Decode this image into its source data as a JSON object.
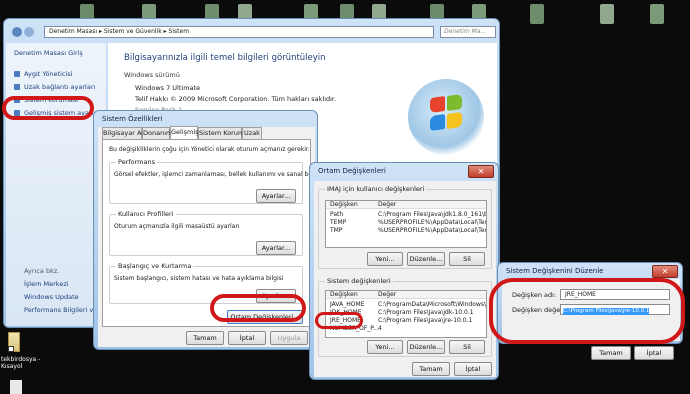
{
  "control_panel": {
    "address": [
      "Denetim Masası",
      "Sistem ve Güvenlik",
      "Sistem"
    ],
    "search_placeholder": "Denetim Ma...",
    "sidebar_home": "Denetim Masası Giriş",
    "sidebar_items": [
      "Aygıt Yöneticisi",
      "Uzak bağlantı ayarları",
      "Sistem koruması",
      "Gelişmiş sistem ayarları"
    ],
    "see_also_title": "Ayrıca bkz.",
    "see_also": [
      "İşlem Merkezi",
      "Windows Update",
      "Performans Bilgileri ve Ara..."
    ],
    "heading": "Bilgisayarınızla ilgili temel bilgileri görüntüleyin",
    "edition_label": "Windows sürümü",
    "edition": "Windows 7 Ultimate",
    "copyright": "Telif Hakkı © 2009 Microsoft Corporation. Tüm hakları saklıdır.",
    "service_pack": "Service Pack 1"
  },
  "system_properties": {
    "title": "Sistem Özellikleri",
    "tabs": [
      "Bilgisayar Adı",
      "Donanım",
      "Gelişmiş",
      "Sistem Koruması",
      "Uzak"
    ],
    "admin_note": "Bu değişikliklerin çoğu için Yönetici olarak oturum açmanız gerekir.",
    "performance": {
      "title": "Performans",
      "desc": "Görsel efektler, işlemci zamanlaması, bellek kullanımı ve sanal bellek",
      "button": "Ayarlar..."
    },
    "user_profiles": {
      "title": "Kullanıcı Profilleri",
      "desc": "Oturum açmanızla ilgili masaüstü ayarları",
      "button": "Ayarlar..."
    },
    "startup": {
      "title": "Başlangıç ve Kurtarma",
      "desc": "Sistem başlangıcı, sistem hatası ve hata ayıklama bilgisi",
      "button": "Ayarlar..."
    },
    "env_button": "Ortam Değişkenleri...",
    "ok": "Tamam",
    "cancel": "İptal",
    "apply": "Uygula"
  },
  "env_vars": {
    "title": "Ortam Değişkenleri",
    "user_group": "IMAJ için kullanıcı değişkenleri",
    "col_var": "Değişken",
    "col_val": "Değer",
    "user_rows": [
      [
        "Path",
        "C:\\Program Files\\Java\\jdk1.8.0_161\\bin"
      ],
      [
        "TEMP",
        "%USERPROFILE%\\AppData\\Local\\Temp"
      ],
      [
        "TMP",
        "%USERPROFILE%\\AppData\\Local\\Temp"
      ]
    ],
    "system_group": "Sistem değişkenleri",
    "system_rows": [
      [
        "JAVA_HOME",
        "C:\\ProgramData\\Microsoft\\Windows\\St..."
      ],
      [
        "JDK_HOME",
        "C:\\Program Files\\Java\\jdk-10.0.1"
      ],
      [
        "JRE_HOME",
        "C:\\Program Files\\Java\\jre-10.0.1"
      ],
      [
        "NUMBER_OF_P...",
        "4"
      ]
    ],
    "new": "Yeni...",
    "edit": "Düzenle...",
    "delete": "Sil",
    "ok": "Tamam",
    "cancel": "İptal"
  },
  "edit_var": {
    "title": "Sistem Değişkenini Düzenle",
    "name_label": "Değişken adı:",
    "name_value": "JRE_HOME",
    "value_label": "Değişken değeri:",
    "value_value": "C:\\Program Files\\Java\\jre-10.0.1",
    "ok": "Tamam",
    "cancel": "İptal"
  },
  "desktop_icon": {
    "label": "tekbirdosya - Kısayol"
  },
  "colors": {
    "highlight": "#d01818",
    "selection": "#3399ff",
    "link": "#1e3f7a"
  }
}
